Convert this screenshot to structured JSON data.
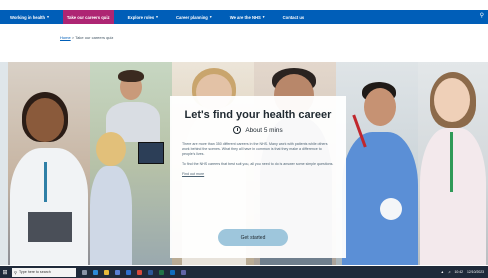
{
  "nav": {
    "items": [
      {
        "label": "Working in health",
        "chevron": "chevron-down-icon",
        "active": false
      },
      {
        "label": "Take our careers quiz",
        "active": true
      },
      {
        "label": "Explore roles",
        "chevron": "chevron-down-icon",
        "active": false
      },
      {
        "label": "Career planning",
        "chevron": "chevron-down-icon",
        "active": false
      },
      {
        "label": "We are the NHS",
        "chevron": "chevron-down-icon",
        "active": false
      },
      {
        "label": "Contact us",
        "active": false
      }
    ],
    "search_icon": "search-icon"
  },
  "breadcrumb": {
    "home": "Home",
    "separator": " > ",
    "current": "Take our careers quiz"
  },
  "card": {
    "title": "Let's find your health career",
    "duration": "About 5 mins",
    "paragraph1": "There are more than 350 different careers in the NHS. Many work with patients while others work behind the scenes. What they all have in common is that they make a difference to people's lives.",
    "paragraph2": "To find the NHS careers that best suit you, all you need to do is answer some simple questions.",
    "link": "Find out more",
    "button": "Get started"
  },
  "taskbar": {
    "search_placeholder": "Type here to search",
    "time": "10:42",
    "date": "12/10/2023"
  },
  "colors": {
    "nav_bg": "#005eb8",
    "active_tab": "#ae2573",
    "button_bg": "#9ec6dc",
    "taskbar_bg": "#1f2a3a"
  }
}
